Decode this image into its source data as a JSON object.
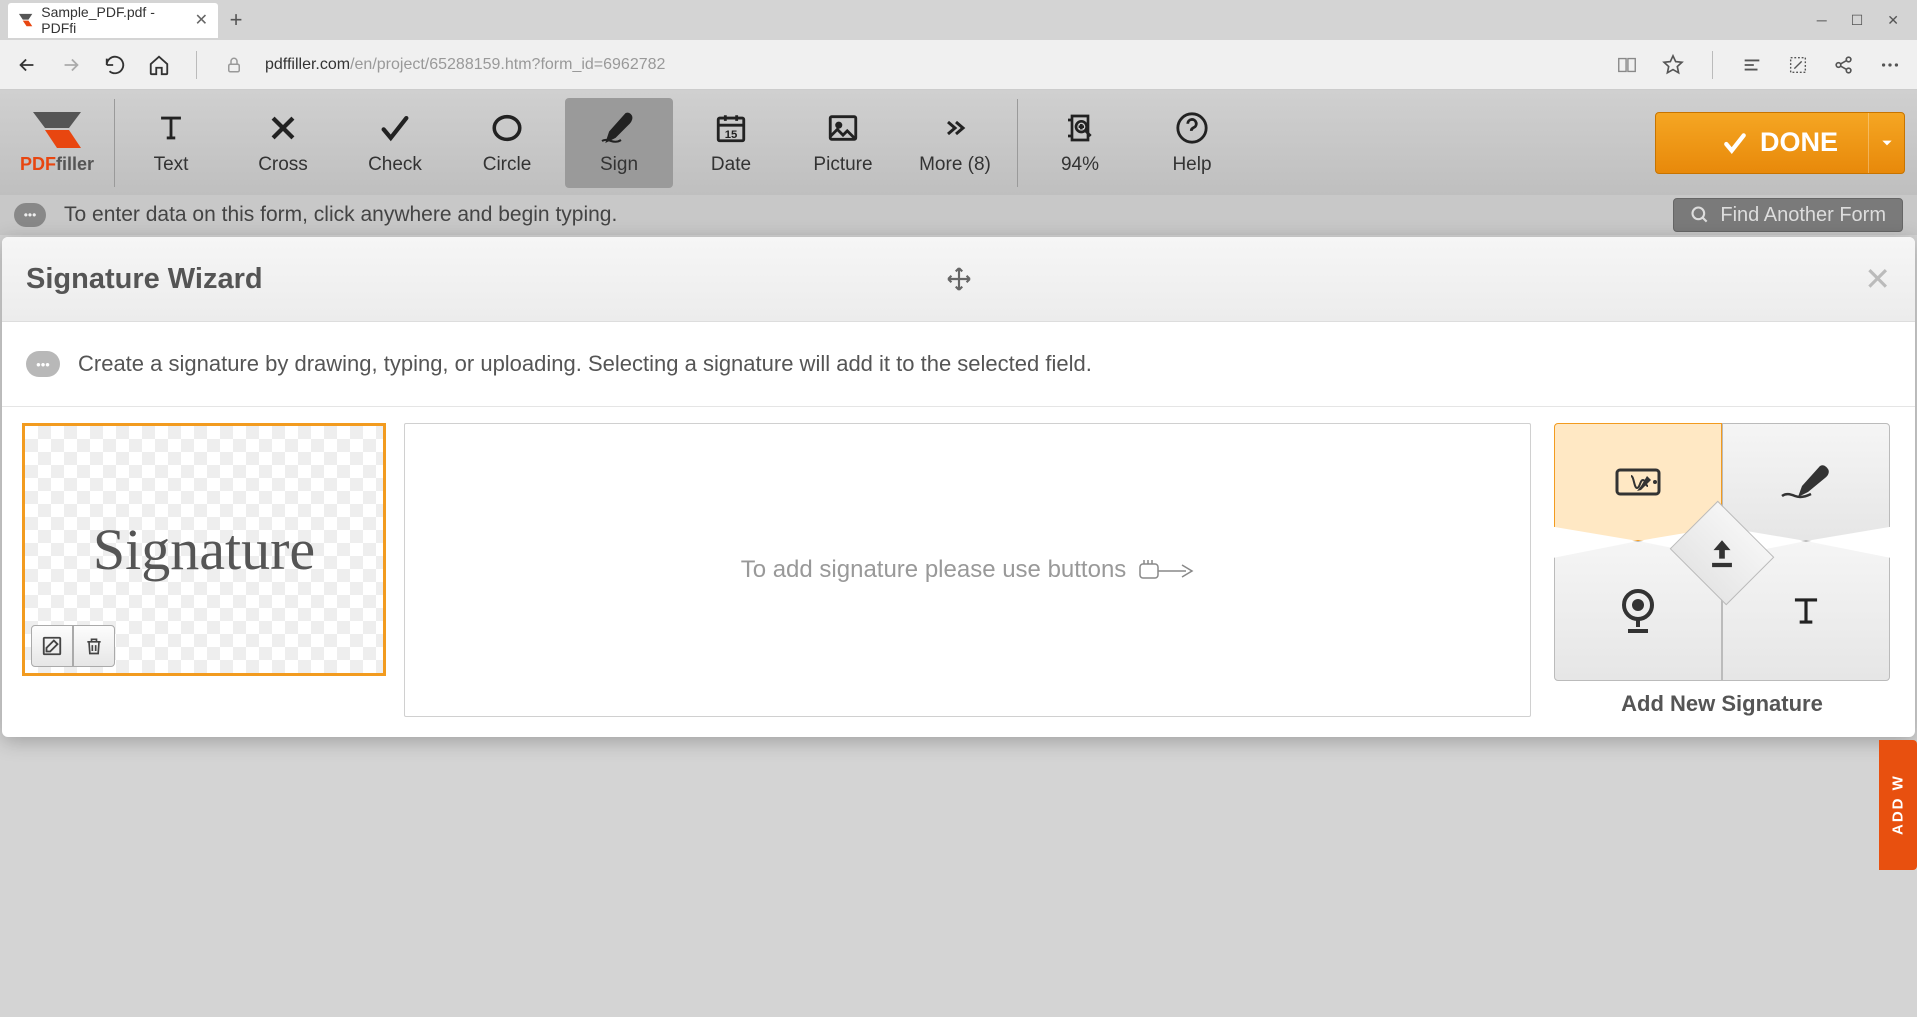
{
  "browser": {
    "tab_title": "Sample_PDF.pdf - PDFfi",
    "url_host": "pdffiller.com",
    "url_path": "/en/project/65288159.htm?form_id=6962782"
  },
  "brand": {
    "part1": "PDF",
    "part2": "filler"
  },
  "tools": {
    "text": "Text",
    "cross": "Cross",
    "check": "Check",
    "circle": "Circle",
    "sign": "Sign",
    "date": "Date",
    "picture": "Picture",
    "more": "More (8)",
    "zoom": "94%",
    "help": "Help",
    "done": "DONE"
  },
  "hints": {
    "top": "To enter data on this form, click anywhere and begin typing.",
    "find": "Find Another Form"
  },
  "modal": {
    "title": "Signature Wizard",
    "info": "Create a signature by drawing, typing, or uploading. Selecting a signature will add it to the selected field.",
    "sample_sig": "Signature",
    "empty_hint": "To add signature please use buttons",
    "add_label": "Add New Signature"
  },
  "side_tab": "ADD W"
}
